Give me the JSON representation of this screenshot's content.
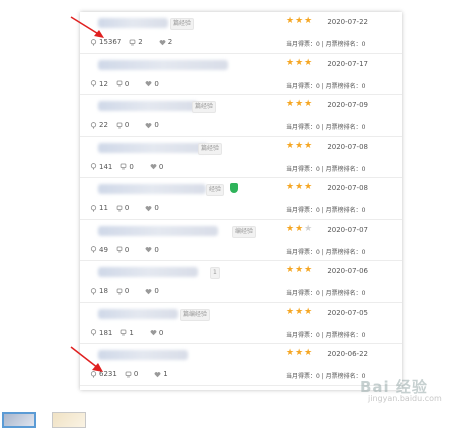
{
  "rows": [
    {
      "tag": "篇经验",
      "views": "15367",
      "comments": "2",
      "likes": "2",
      "stars": 3,
      "date": "2020-07-22",
      "rank": "当月得票：0 | 月票榜排名：0"
    },
    {
      "tag": "",
      "views": "12",
      "comments": "0",
      "likes": "0",
      "stars": 3,
      "date": "2020-07-17",
      "rank": "当月得票：0 | 月票榜排名：0"
    },
    {
      "tag": "篇经验",
      "views": "22",
      "comments": "0",
      "likes": "0",
      "stars": 3,
      "date": "2020-07-09",
      "rank": "当月得票：0 | 月票榜排名：0"
    },
    {
      "tag": "篇经验",
      "views": "141",
      "comments": "0",
      "likes": "0",
      "stars": 3,
      "date": "2020-07-08",
      "rank": "当月得票：0 | 月票榜排名：0"
    },
    {
      "tag": "经验",
      "views": "11",
      "comments": "0",
      "likes": "0",
      "stars": 3,
      "date": "2020-07-08",
      "rank": "当月得票：0 | 月票榜排名：0"
    },
    {
      "tag": "编经验",
      "views": "49",
      "comments": "0",
      "likes": "0",
      "stars": 2,
      "date": "2020-07-07",
      "rank": "当月得票：0 | 月票榜排名：0"
    },
    {
      "tag": "1",
      "views": "18",
      "comments": "0",
      "likes": "0",
      "stars": 3,
      "date": "2020-07-06",
      "rank": "当月得票：0 | 月票榜排名：0"
    },
    {
      "tag": "篇编经验",
      "views": "181",
      "comments": "1",
      "likes": "0",
      "stars": 3,
      "date": "2020-07-05",
      "rank": "当月得票：0 | 月票榜排名：0"
    },
    {
      "tag": "",
      "views": "6231",
      "comments": "0",
      "likes": "1",
      "stars": 3,
      "date": "2020-06-22",
      "rank": "当月得票：0 | 月票榜排名：0"
    }
  ],
  "watermark": {
    "main": "Bai 经验",
    "sub": "jingyan.baidu.com"
  },
  "colors": {
    "star_on": "#f5a623",
    "star_off": "#d0d0d0",
    "arrow": "#e02020"
  }
}
